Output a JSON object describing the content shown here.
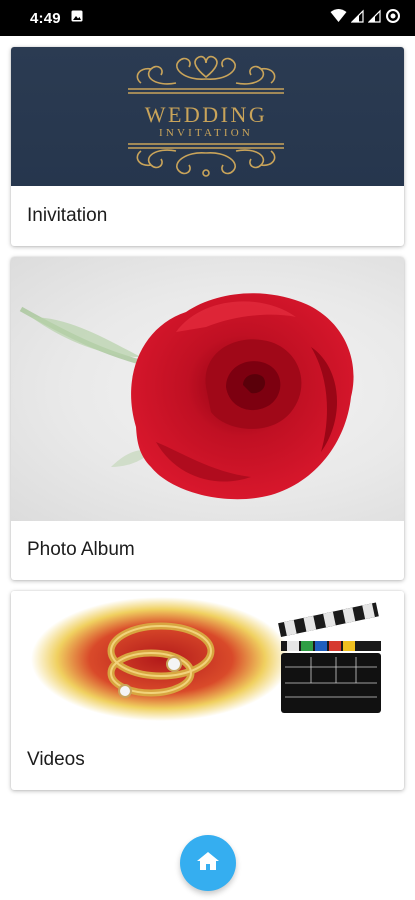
{
  "status_bar": {
    "time": "4:49",
    "icons": [
      "gallery-icon",
      "wifi-icon",
      "signal-icon",
      "signal-icon",
      "sync-icon"
    ]
  },
  "cards": {
    "invitation": {
      "label": "Inivitation",
      "banner_title": "WEDDING",
      "banner_subtitle": "INVITATION"
    },
    "album": {
      "label": "Photo Album"
    },
    "videos": {
      "label": "Videos"
    }
  },
  "fab": {
    "icon": "home-icon"
  },
  "colors": {
    "status_bar_bg": "#000000",
    "banner_bg": "#2b3b52",
    "gold": "#c9a45a",
    "rose_red": "#c01023",
    "fab_blue": "#35aef0"
  }
}
